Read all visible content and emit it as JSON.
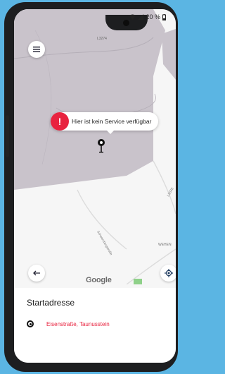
{
  "status": {
    "battery": "20 %",
    "wifi_icon": "wifi-icon",
    "signal_icon": "signal-icon",
    "battery_icon": "battery-icon"
  },
  "map": {
    "road_labels": [
      "L3274",
      "L3035",
      "Schwarzbergstraße",
      "WEHEN"
    ],
    "attribution": "Google",
    "tooltip_message": "Hier ist kein Service verfügbar",
    "alert_symbol": "!",
    "colors": {
      "no_service_area": "#c9c3cb",
      "map_background": "#f6f6f6",
      "alert_red": "#e8233f"
    }
  },
  "controls": {
    "menu_icon": "menu-icon",
    "back_icon": "arrow-left-icon",
    "locate_icon": "my-location-icon"
  },
  "sheet": {
    "title": "Startadresse",
    "address": "Eisenstraße, Taunusstein"
  }
}
